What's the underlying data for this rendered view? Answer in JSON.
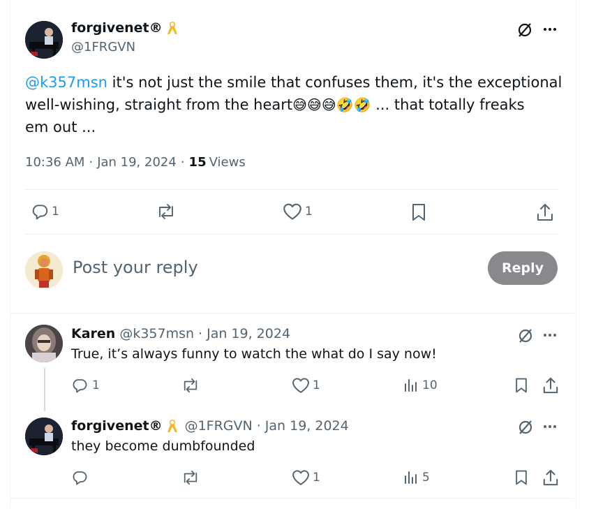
{
  "main_post": {
    "author_name": "forgivenet®",
    "handle": "@1FRGVN",
    "mention": "@k357msn",
    "text_line1": " it's not just the smile that confuses them, it's the exceptional",
    "text_line2": "well-wishing, straight from the heart",
    "emojis": "😅😅😅🤣🤣",
    "text_line2_end": " ... that totally freaks",
    "text_line3": "em out ...",
    "time": "10:36 AM",
    "date": "Jan 19, 2024",
    "views_count": "15",
    "views_label": "Views",
    "replies": "1",
    "likes": "1"
  },
  "composer": {
    "placeholder": "Post your reply",
    "button_label": "Reply"
  },
  "replies": [
    {
      "author_name": "Karen",
      "handle": "@k357msn",
      "date": "Jan 19, 2024",
      "text": "True, it’s always funny to watch the what do I say now!",
      "replies": "1",
      "likes": "1",
      "views": "10"
    },
    {
      "author_name": "forgivenet®",
      "handle": "@1FRGVN",
      "date": "Jan 19, 2024",
      "text": "they become dumbfounded",
      "likes": "1",
      "views": "5"
    }
  ],
  "colors": {
    "link": "#1d9bf0",
    "muted": "#536471",
    "ribbon": "#f2b92e"
  }
}
